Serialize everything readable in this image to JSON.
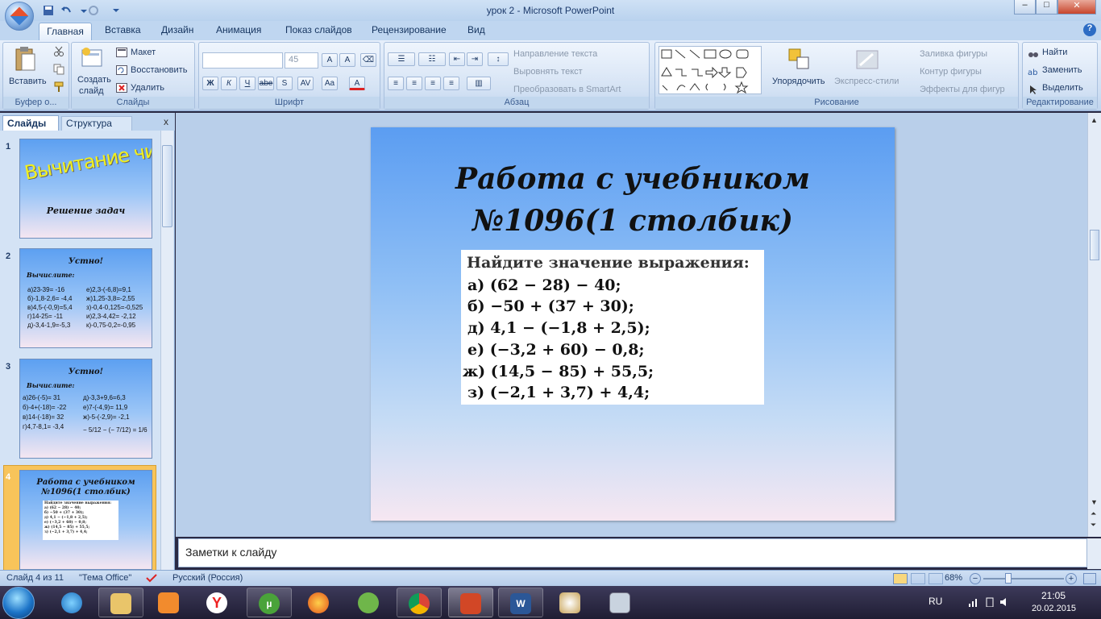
{
  "window": {
    "title": "урок 2 - Microsoft PowerPoint",
    "btn_min": "–",
    "btn_max": "□",
    "btn_close": "✕"
  },
  "ribbon_tabs": [
    "Главная",
    "Вставка",
    "Дизайн",
    "Анимация",
    "Показ слайдов",
    "Рецензирование",
    "Вид"
  ],
  "help": "?",
  "clipboard": {
    "paste": "Вставить",
    "label": "Буфер о..."
  },
  "slides_grp": {
    "create1": "Создать",
    "create2": "слайд",
    "layout": "Макет",
    "reset": "Восстановить",
    "delete": "Удалить",
    "label": "Слайды"
  },
  "font_grp": {
    "size": "45",
    "label": "Шрифт",
    "bold": "Ж",
    "italic": "К",
    "underline": "Ч",
    "strike": "abe",
    "spacing": "AV",
    "case": "Aa",
    "color": "A"
  },
  "para_grp": {
    "text_dir": "Направление текста",
    "align_text": "Выровнять текст",
    "smartart": "Преобразовать в SmartArt",
    "label": "Абзац"
  },
  "draw_grp": {
    "arrange": "Упорядочить",
    "quick_styles": "Экспресс-стили",
    "fill": "Заливка фигуры",
    "outline": "Контур фигуры",
    "effects": "Эффекты для фигур",
    "label": "Рисование"
  },
  "edit_grp": {
    "find": "Найти",
    "replace": "Заменить",
    "select": "Выделить",
    "label": "Редактирование"
  },
  "left_tabs": {
    "slides": "Слайды",
    "outline": "Структура",
    "close": "x"
  },
  "thumbs": [
    {
      "num": "1",
      "title": "Вычитание чисел",
      "sub": "Решение задач"
    },
    {
      "num": "2",
      "title": "Устно!",
      "calc": "Вычислите:",
      "left": [
        "а)23-39= -16",
        "б)-1,8-2,6= -4,4",
        "в)4,5-(-0,9)=5,4",
        "г)14-25= -11",
        "д)-3,4-1,9=-5,3"
      ],
      "right": [
        "е)2,3-(-6,8)=9,1",
        "ж)1,25-3,8=-2,55",
        "з)-0,4-0,125=-0,525",
        "и)2,3-4,42= -2,12",
        "к)-0,75-0,2=-0,95"
      ]
    },
    {
      "num": "3",
      "title": "Устно!",
      "calc": "Вычислите:",
      "left": [
        "а)26-(-5)= 31",
        "б)-4+(-18)= -22",
        "в)14-(-18)= 32",
        "г)4,7-8,1= -3,4"
      ],
      "right": [
        "д)-3,3+9,6=6,3",
        "е)7-(-4,9)= 11,9",
        "ж)-5-(-2,9)= -2,1",
        "− 5/12 − (− 7/12) = 1/6"
      ]
    },
    {
      "num": "4",
      "title1": "Работа с учебником",
      "title2": "№1096(1 столбик)"
    }
  ],
  "slide": {
    "title1": "Работа с учебником",
    "title2": "№1096(1 столбик)",
    "exercise_head": "Найдите значение выражения:",
    "lines": [
      "а) (62 − 28) − 40;",
      "б) −50 + (37 + 30);",
      "д) 4,1 − (−1,8 + 2,5);",
      "е) (−3,2 + 60) − 0,8;",
      "ж) (14,5 − 85) + 55,5;",
      "з) (−2,1 + 3,7) + 4,4;"
    ]
  },
  "notes": {
    "placeholder": "Заметки к слайду"
  },
  "status": {
    "slide_of": "Слайд 4 из 11",
    "theme": "\"Тема Office\"",
    "lang": "Русский (Россия)",
    "zoom": "68%",
    "zoom_level": 0.68
  },
  "tray": {
    "lang": "RU",
    "time": "21:05",
    "date": "20.02.2015"
  },
  "colors": {
    "ribbon": "#dbe7f7",
    "slide_top": "#5b9df2",
    "slide_bottom": "#f6e7f2",
    "selected_thumb": "#f8c45a"
  }
}
